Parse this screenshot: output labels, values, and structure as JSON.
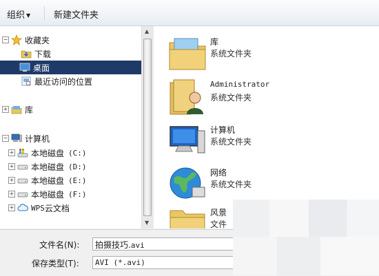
{
  "toolbar": {
    "organize": "组织",
    "new_folder": "新建文件夹"
  },
  "nav": {
    "favorites": "收藏夹",
    "downloads": "下载",
    "desktop": "桌面",
    "recent": "最近访问的位置",
    "libraries": "库",
    "computer": "计算机",
    "drives": [
      {
        "label": "本地磁盘",
        "letter": "(C:)"
      },
      {
        "label": "本地磁盘",
        "letter": "(D:)"
      },
      {
        "label": "本地磁盘",
        "letter": "(E:)"
      },
      {
        "label": "本地磁盘",
        "letter": "(F:)"
      }
    ],
    "wps_prefix": "WPS",
    "wps_rest": "云文档"
  },
  "content": {
    "items": [
      {
        "name": "库",
        "type": "系统文件夹"
      },
      {
        "name": "Administrator",
        "type": "系统文件夹"
      },
      {
        "name": "计算机",
        "type": "系统文件夹"
      },
      {
        "name": "网络",
        "type": "系统文件夹"
      },
      {
        "name": "风景",
        "type": "文件"
      }
    ]
  },
  "bottom": {
    "filename_label": "文件名(N):",
    "filename_value_cn": "拍摄技巧.",
    "filename_value_ext": "avi",
    "savetype_label": "保存类型(T):",
    "savetype_value": "AVI (*.avi)"
  },
  "colors": {
    "selection": "#1f3a68",
    "window_bg": "#f0f0f0"
  }
}
